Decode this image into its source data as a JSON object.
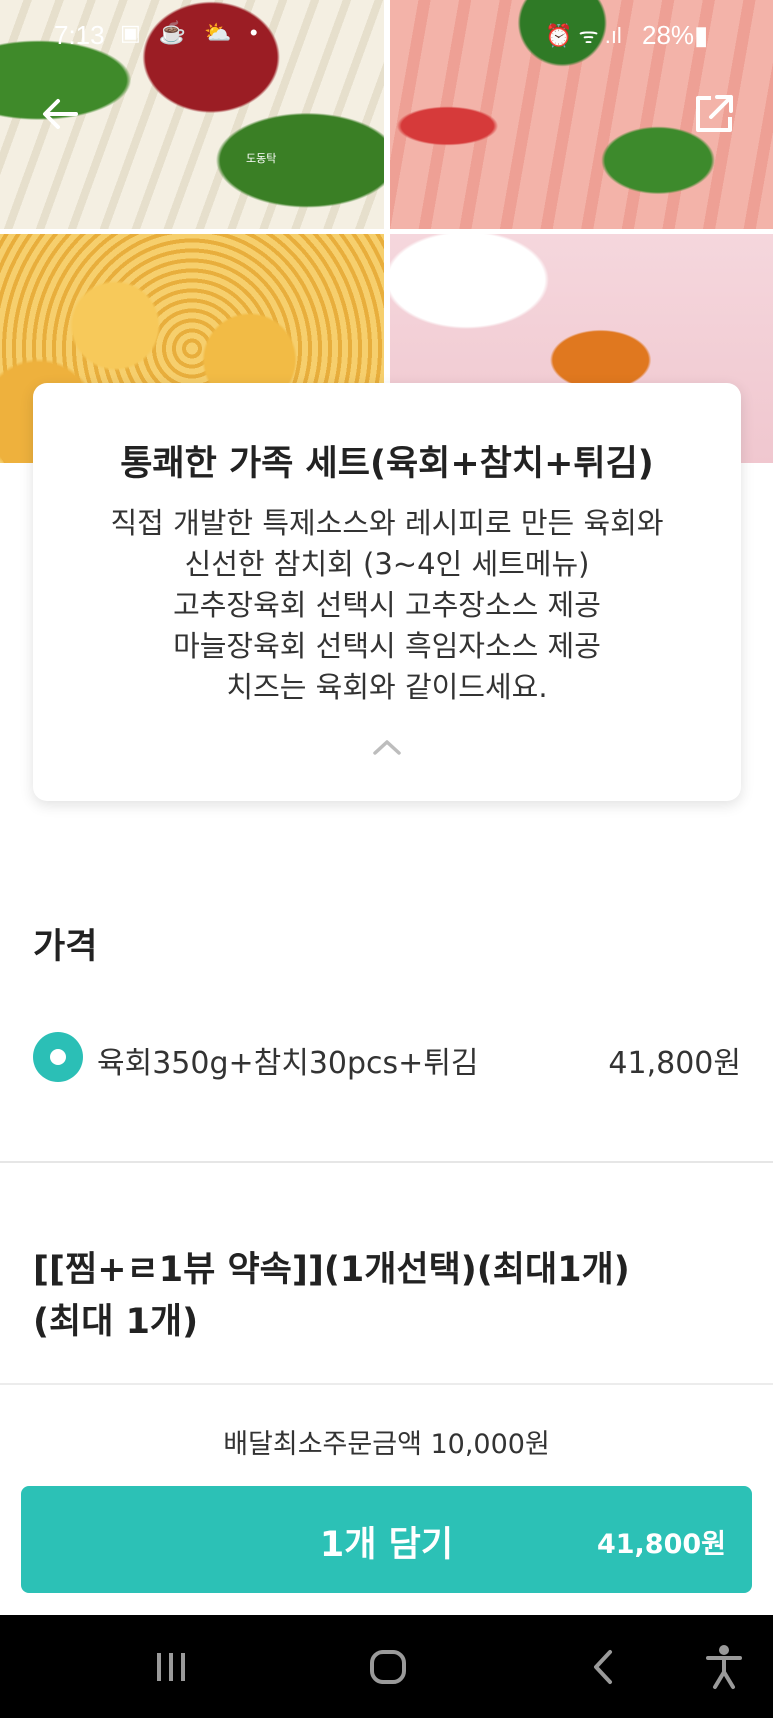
{
  "status_bar": {
    "time": "7:13",
    "left_icons": "▣ ☕ ⛅ •",
    "right_icons": "⏰ ᯤ .ıl",
    "battery": "28%▮"
  },
  "hero": {
    "watermark": "도동탁"
  },
  "card": {
    "title": "통쾌한 가족 세트(육회+참치+튀김)",
    "description_lines": [
      "직접 개발한 특제소스와 레시피로 만든 육회와",
      "신선한 참치회 (3~4인 세트메뉴)",
      "고추장육회 선택시 고추장소스 제공",
      "마늘장육회 선택시 흑임자소스 제공",
      "치즈는 육회와 같이드세요."
    ]
  },
  "price_section": {
    "title": "가격",
    "option": {
      "label": "육회350g+참치30pcs+튀김",
      "price": "41,800원",
      "selected": true
    }
  },
  "option_group": {
    "title_line1": "[[찜+ㄹ1뷰 약속]](1개선택)(최대1개)",
    "title_line2": "(최대 1개)"
  },
  "bottom": {
    "min_order": "배달최소주문금액 10,000원",
    "add_label": "1개 담기",
    "add_price": "41,800원"
  },
  "colors": {
    "accent": "#2cc1b6"
  },
  "icons": {
    "back": "arrow-left-icon",
    "share": "external-link-icon",
    "collapse": "chevron-up-icon"
  }
}
